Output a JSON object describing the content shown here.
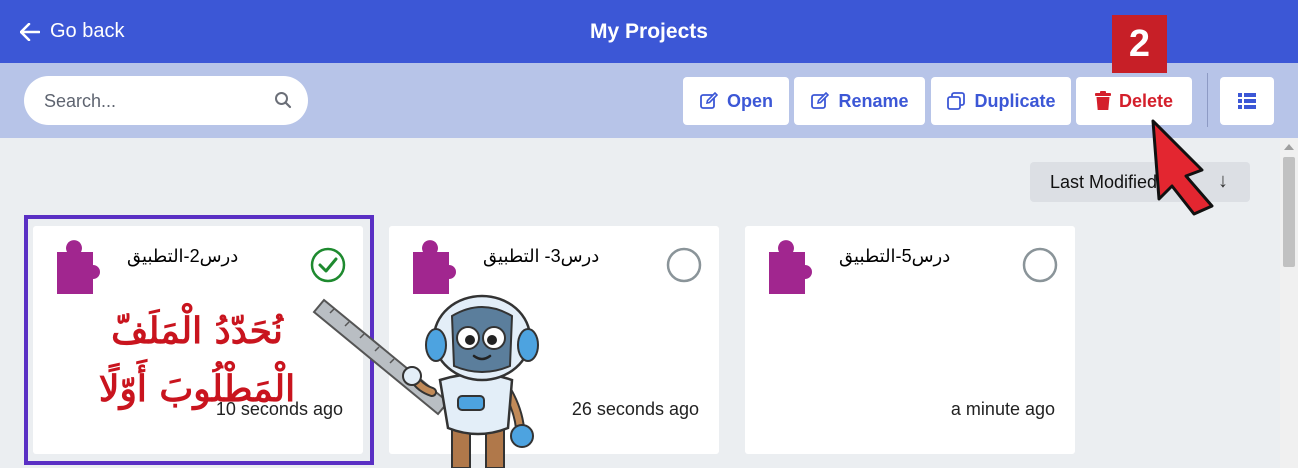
{
  "header": {
    "back_label": "Go back",
    "title": "My Projects"
  },
  "toolbar": {
    "search_placeholder": "Search...",
    "open_label": "Open",
    "rename_label": "Rename",
    "duplicate_label": "Duplicate",
    "delete_label": "Delete"
  },
  "sort": {
    "label": "Last Modified"
  },
  "projects": [
    {
      "name": "درس2-التطبيق",
      "time": "10 seconds ago",
      "selected": true
    },
    {
      "name": "درس3- التطبيق",
      "time": "26 seconds ago",
      "selected": false
    },
    {
      "name": "درس5-التطبيق",
      "time": "a minute ago",
      "selected": false
    }
  ],
  "annotation": {
    "step_number": "2",
    "arabic_line1": "نُحَدّدُ الْمَلَفّ",
    "arabic_line2": "الْمَطْلُوبَ أَوّلًا"
  },
  "colors": {
    "header_bg": "#3c57d6",
    "toolbar_bg": "#b7c4e8",
    "accent": "#3c57d6",
    "delete": "#d41f2b",
    "puzzle": "#a1268f",
    "selected_check": "#1e8a2f",
    "selection_border": "#5a2fc4"
  }
}
